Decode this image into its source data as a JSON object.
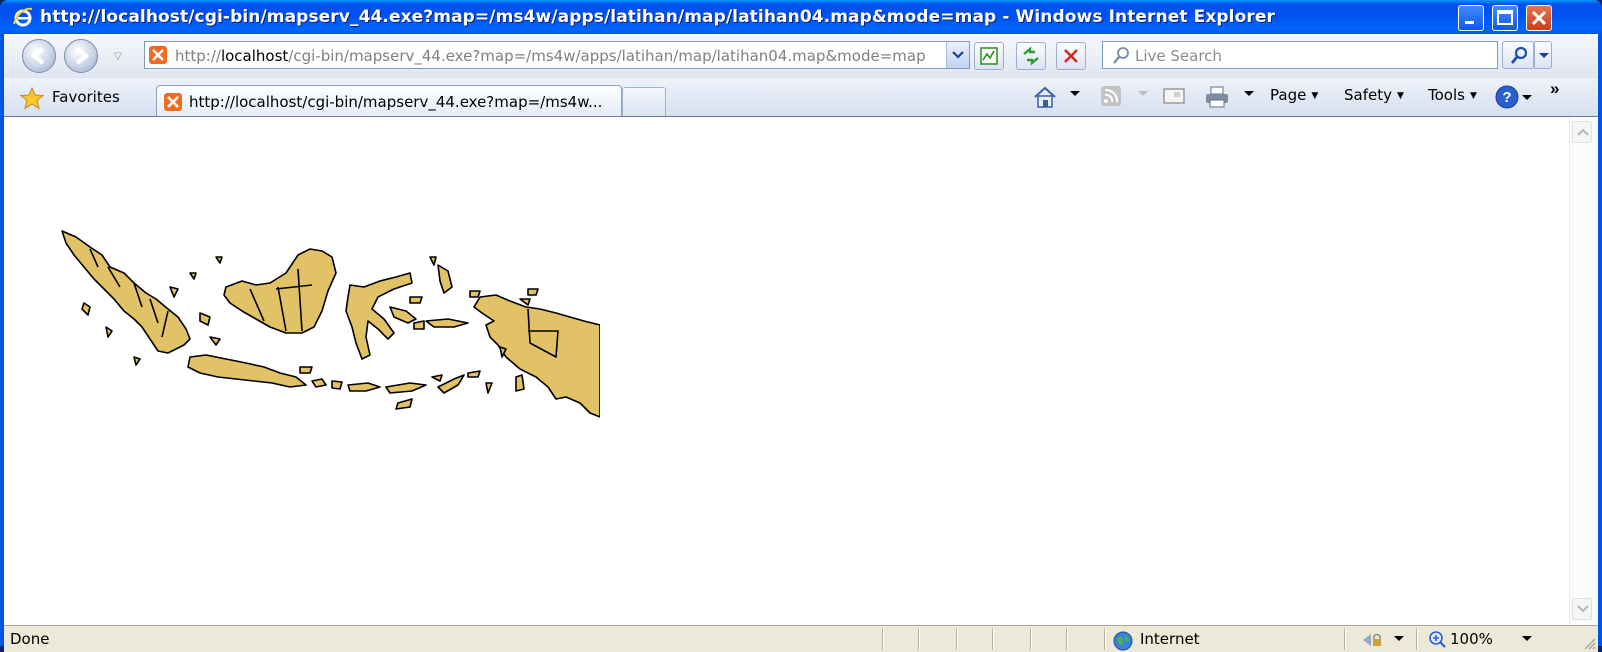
{
  "window": {
    "title": "http://localhost/cgi-bin/mapserv_44.exe?map=/ms4w/apps/latihan/map/latihan04.map&mode=map - Windows Internet Explorer"
  },
  "address_bar": {
    "url_prefix": "http://",
    "url_host": "localhost",
    "url_path": "/cgi-bin/mapserv_44.exe?map=/ms4w/apps/latihan/map/latihan04.map&mode=map"
  },
  "search": {
    "placeholder": "Live Search"
  },
  "command_bar": {
    "favorites_label": "Favorites",
    "tab_title": "http://localhost/cgi-bin/mapserv_44.exe?map=/ms4w...",
    "page_label": "Page",
    "safety_label": "Safety",
    "tools_label": "Tools",
    "more_label": "»"
  },
  "status_bar": {
    "status_text": "Done",
    "zone_label": "Internet",
    "zoom_label": "100%"
  },
  "colors": {
    "map_fill": "#e2c266",
    "map_stroke": "#000000",
    "titlebar": "#0054e3"
  },
  "icons": [
    "ie-logo-icon",
    "back-icon",
    "forward-icon",
    "compatibility-icon",
    "refresh-icon",
    "stop-icon",
    "search-icon",
    "favorites-star-icon",
    "home-icon",
    "rss-icon",
    "mail-icon",
    "print-icon",
    "help-icon",
    "globe-icon",
    "protected-mode-icon",
    "zoom-icon"
  ]
}
